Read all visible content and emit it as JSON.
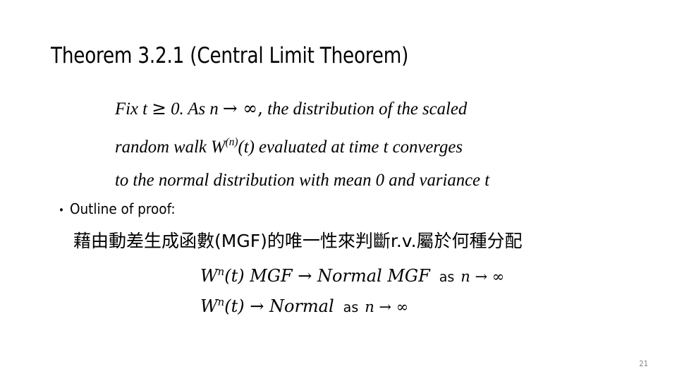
{
  "slide": {
    "title": "Theorem 3.2.1 (Central Limit Theorem)",
    "page_number": "21",
    "background_color": "#ffffff",
    "text_color": "#000000",
    "page_number_color": "#808080"
  },
  "theorem": {
    "line1_a": "Fix t ",
    "line1_ge": "≥",
    "line1_b": " 0. As n ",
    "line1_arrow": "→",
    "line1_inf": " ∞,",
    "line1_c": " the distribution of  the scaled",
    "line2_a": "random walk  W",
    "line2_sup": "(n)",
    "line2_b": "(t) evaluated  at time t converges",
    "line3": "to the normal distribution with mean 0 and variance t"
  },
  "outline": {
    "bullet_glyph": "•",
    "bullet_label": "Outline of proof:",
    "cjk_note": "藉由動差生成函數(MGF)的唯一性來判斷r.v.屬於何種分配"
  },
  "equations": [
    {
      "lhs_base": "W",
      "lhs_sup": "n",
      "lhs_rest": "(t) MGF ",
      "arrow": "→",
      "rhs": " Normal MGF",
      "as_label": "as",
      "limit_var": "n ",
      "limit_arrow": "→",
      "limit_value": " ∞"
    },
    {
      "lhs_base": "W",
      "lhs_sup": "n",
      "lhs_rest": "(t) ",
      "arrow": "→",
      "rhs": " Normal",
      "as_label": "as",
      "limit_var": "n ",
      "limit_arrow": "→",
      "limit_value": " ∞"
    }
  ]
}
